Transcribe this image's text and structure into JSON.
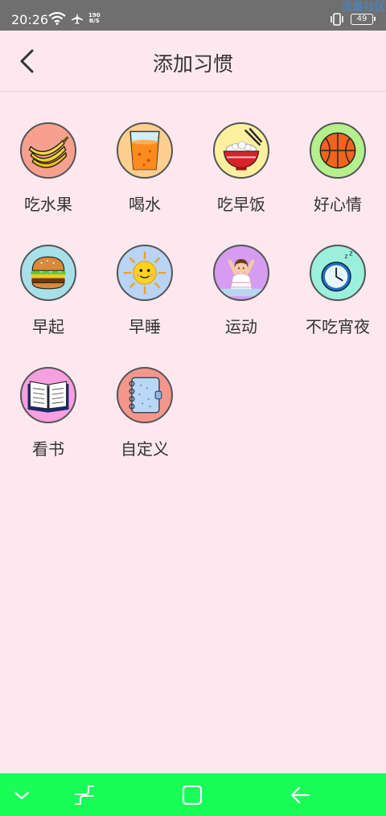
{
  "status_bar": {
    "time": "20:26",
    "net_speed_value": "190",
    "net_speed_unit": "B/S",
    "battery": "49",
    "watermark": "流量社区"
  },
  "header": {
    "title": "添加习惯"
  },
  "habits": [
    {
      "label": "吃水果",
      "icon": "banana-icon",
      "bg": "#f7a08f"
    },
    {
      "label": "喝水",
      "icon": "juice-glass-icon",
      "bg": "#ffcf8f"
    },
    {
      "label": "吃早饭",
      "icon": "rice-bowl-icon",
      "bg": "#fff0a0"
    },
    {
      "label": "好心情",
      "icon": "basketball-icon",
      "bg": "#b4f08c"
    },
    {
      "label": "早起",
      "icon": "burger-icon",
      "bg": "#a8e0ea"
    },
    {
      "label": "早睡",
      "icon": "sun-icon",
      "bg": "#b8d4f6"
    },
    {
      "label": "运动",
      "icon": "stretching-person-icon",
      "bg": "#d69cf2"
    },
    {
      "label": "不吃宵夜",
      "icon": "alarm-clock-icon",
      "bg": "#9af0dc"
    },
    {
      "label": "看书",
      "icon": "open-book-icon",
      "bg": "#f6a0e0"
    },
    {
      "label": "自定义",
      "icon": "notebook-icon",
      "bg": "#f5968c"
    }
  ],
  "nav_bar": {
    "color": "#17ff57"
  }
}
